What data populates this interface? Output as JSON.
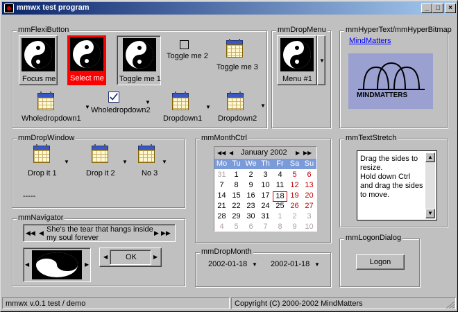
{
  "window": {
    "title": "mmwx test program",
    "buttons": {
      "minimize": "_",
      "maximize": "□",
      "close": "×"
    }
  },
  "flexi": {
    "group_title": "mmFlexiButton",
    "focus_me": "Focus me",
    "select_me": "Select me",
    "toggle_me_1": "Toggle me 1",
    "toggle_me_2": "Toggle me 2",
    "toggle_me_3": "Toggle me 3",
    "wholedropdown1": "Wholedropdown1",
    "wholedropdown2": "Wholedropdown2",
    "dropdown1": "Dropdown1",
    "dropdown2": "Dropdown2",
    "select_color": "#ff0000"
  },
  "dropmenu": {
    "group_title": "mmDropMenu",
    "label": "Menu #1"
  },
  "hyper": {
    "group_title": "mmHyperText/mmHyperBitmap",
    "link": "MindMatters",
    "logo_text": "MINDMATTERS"
  },
  "dropwindow": {
    "group_title": "mmDropWindow",
    "item1": "Drop it 1",
    "item2": "Drop it 2",
    "item3": "No 3",
    "dashes": "-----"
  },
  "monthctrl": {
    "group_title": "mmMonthCtrl",
    "month_label": "January 2002",
    "weekdays": [
      "Mo",
      "Tu",
      "We",
      "Th",
      "Fr",
      "Sa",
      "Su"
    ],
    "weeks": [
      [
        "31",
        "1",
        "2",
        "3",
        "4",
        "5",
        "6"
      ],
      [
        "7",
        "8",
        "9",
        "10",
        "11",
        "12",
        "13"
      ],
      [
        "14",
        "15",
        "16",
        "17",
        "18",
        "19",
        "20"
      ],
      [
        "21",
        "22",
        "23",
        "24",
        "25",
        "26",
        "27"
      ],
      [
        "28",
        "29",
        "30",
        "31",
        "1",
        "2",
        "3"
      ],
      [
        "4",
        "5",
        "6",
        "7",
        "8",
        "9",
        "10"
      ]
    ],
    "today": "18"
  },
  "textstretch": {
    "group_title": "mmTextStretch",
    "text": "Drag the sides to resize.\nHold down Ctrl and drag the sides to move."
  },
  "navigator": {
    "group_title": "mmNavigator",
    "text": "She's the tear that hangs inside my soul forever",
    "ok": "OK"
  },
  "dropmonth": {
    "group_title": "mmDropMonth",
    "value1": "2002-01-18",
    "value2": "2002-01-18"
  },
  "logon": {
    "group_title": "mmLogonDialog",
    "button": "Logon"
  },
  "status": {
    "left": "mmwx v.0.1 test / demo",
    "right": "Copyright (C) 2000-2002 MindMatters"
  }
}
